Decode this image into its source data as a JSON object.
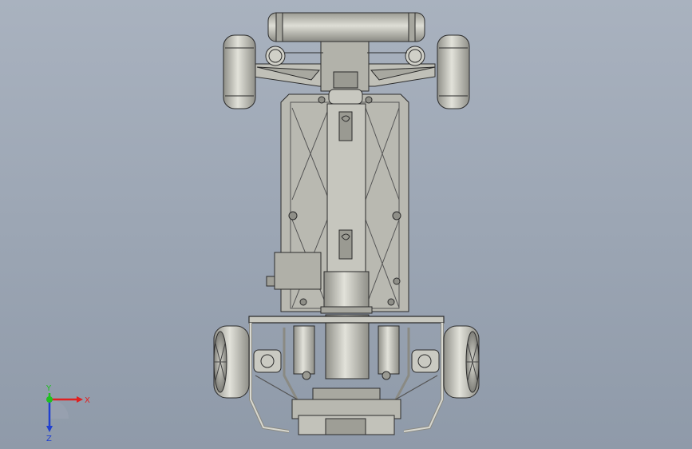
{
  "viewport": {
    "background_top": "#a9b2bf",
    "background_bottom": "#8f9aa9",
    "part_fill": "#b9b9b1",
    "part_fill_light": "#d4d4cc",
    "part_fill_dark": "#8f8f88",
    "edge_color": "#2b2b2b"
  },
  "triad": {
    "x_label": "X",
    "y_label": "Y",
    "z_label": "Z",
    "x_color": "#e02020",
    "y_color": "#20c020",
    "z_color": "#2040d0"
  }
}
